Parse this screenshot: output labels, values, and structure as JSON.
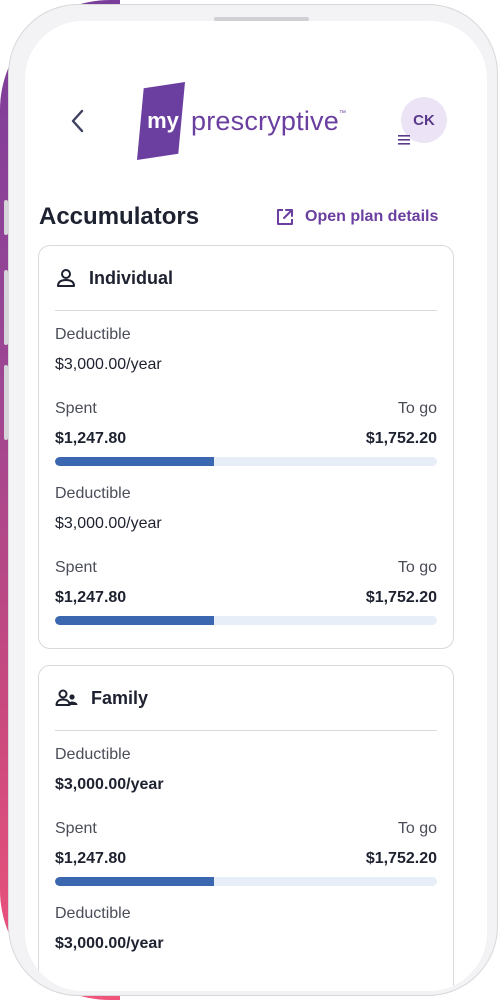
{
  "header": {
    "logo_mark": "my",
    "logo_text": "prescryptive",
    "logo_tm": "™",
    "avatar_initials": "CK"
  },
  "page": {
    "title": "Accumulators",
    "open_plan_label": "Open plan details"
  },
  "cards": [
    {
      "title": "Individual",
      "icon": "person-icon",
      "groups": [
        {
          "label": "Deductible",
          "value": "$3,000.00/year",
          "spent_label": "Spent",
          "togo_label": "To go",
          "spent": "$1,247.80",
          "togo": "$1,752.20",
          "progress": 0.4159
        },
        {
          "label": "Deductible",
          "value": "$3,000.00/year",
          "spent_label": "Spent",
          "togo_label": "To go",
          "spent": "$1,247.80",
          "togo": "$1,752.20",
          "progress": 0.4159
        }
      ]
    },
    {
      "title": "Family",
      "icon": "family-icon",
      "groups": [
        {
          "label": "Deductible",
          "value": "$3,000.00/year",
          "spent_label": "Spent",
          "togo_label": "To go",
          "spent": "$1,247.80",
          "togo": "$1,752.20",
          "progress": 0.4159
        },
        {
          "label": "Deductible",
          "value": "$3,000.00/year"
        }
      ]
    }
  ],
  "colors": {
    "brand": "#6b3fa0",
    "progress": "#3a67b0",
    "progress_track": "#e8eef8"
  }
}
